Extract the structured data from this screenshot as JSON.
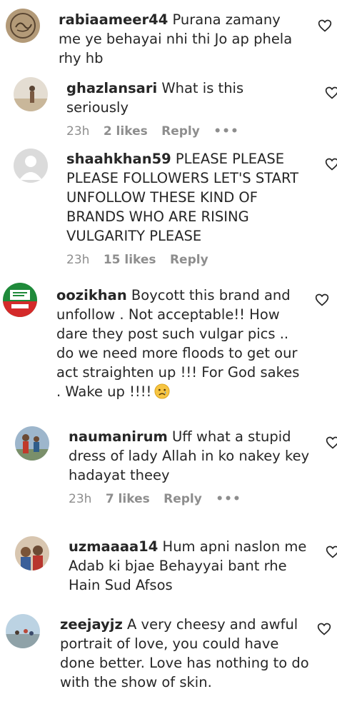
{
  "comments": [
    {
      "username": "rabiaameer44",
      "text": "Purana zamany me ye behayai nhi thi Jo ap phela rhy hb"
    },
    {
      "username": "ghazlansari",
      "text": "What is this seriously",
      "time": "23h",
      "likes": "2 likes",
      "reply": "Reply",
      "more": "•••"
    },
    {
      "username": "shaahkhan59",
      "text": "PLEASE PLEASE PLEASE FOLLOWERS LET'S START UNFOLLOW THESE KIND OF BRANDS WHO ARE RISING VULGARITY PLEASE",
      "time": "23h",
      "likes": "15 likes",
      "reply": "Reply"
    },
    {
      "username": "oozikhan",
      "text": "Boycott this brand and unfollow . Not acceptable!! How dare they post such vulgar pics .. do we need more floods to get our act straighten up !!! For God sakes . Wake up !!!!",
      "emoji": "sad-face"
    },
    {
      "username": "naumanirum",
      "text": "Uff what a stupid dress of lady Allah in ko nakey key hadayat theey",
      "time": "23h",
      "likes": "7 likes",
      "reply": "Reply",
      "more": "•••"
    },
    {
      "username": "uzmaaaa14",
      "text": "Hum apni naslon me Adab ki bjae Behayyai bant rhe Hain Sud Afsos"
    },
    {
      "username": "zeejayjz",
      "text": "A very cheesy and awful portrait of love, you could have done better. Love has nothing to do with the show of skin."
    }
  ],
  "colors": {
    "text": "#262626",
    "muted": "#8e8e8e",
    "background": "#ffffff"
  }
}
